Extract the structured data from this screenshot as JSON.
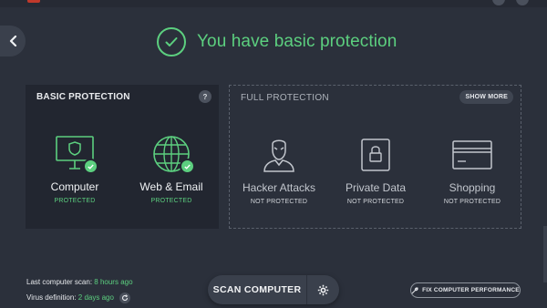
{
  "colors": {
    "accent_green": "#5ccf7f",
    "background": "#2b303b",
    "panel": "#222630"
  },
  "status": {
    "title": "You have basic protection",
    "icon": "check-circle-icon"
  },
  "basic_protection": {
    "title": "BASIC PROTECTION",
    "help": "?",
    "items": [
      {
        "name": "Computer",
        "status": "PROTECTED",
        "icon": "monitor-shield-icon"
      },
      {
        "name": "Web & Email",
        "status": "PROTECTED",
        "icon": "globe-icon"
      }
    ]
  },
  "full_protection": {
    "title": "FULL PROTECTION",
    "show_more": "SHOW MORE",
    "items": [
      {
        "name": "Hacker Attacks",
        "status": "NOT PROTECTED",
        "icon": "hacker-icon"
      },
      {
        "name": "Private Data",
        "status": "NOT PROTECTED",
        "icon": "lock-icon"
      },
      {
        "name": "Shopping",
        "status": "NOT PROTECTED",
        "icon": "credit-card-icon"
      }
    ]
  },
  "footer": {
    "last_scan_label": "Last computer scan:",
    "last_scan_value": "8 hours ago",
    "virus_def_label": "Virus definition:",
    "virus_def_value": "2 days ago",
    "scan_button": "SCAN COMPUTER",
    "fix_button": "FIX COMPUTER PERFORMANCE"
  }
}
